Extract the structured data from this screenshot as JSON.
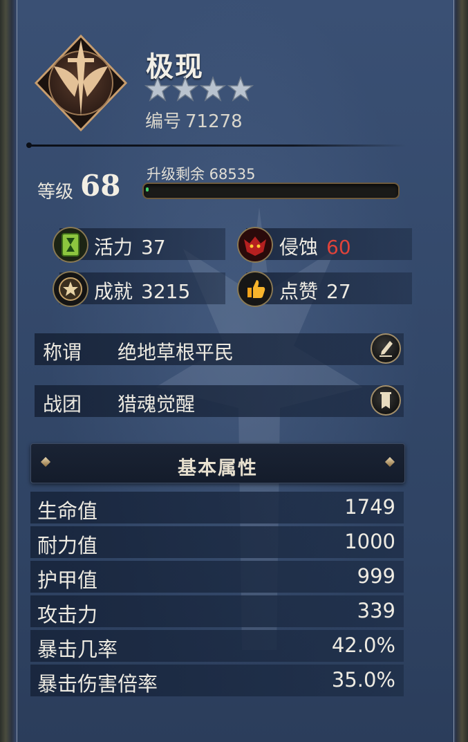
{
  "character": {
    "name": "极现",
    "star_count": 4,
    "id_label": "编号",
    "id_value": "71278"
  },
  "level": {
    "label": "等级",
    "value": "68",
    "xp_label": "升级剩余 68535",
    "xp_progress": 0.01
  },
  "stats": {
    "vitality": {
      "label": "活力",
      "value": "37",
      "icon": "hourglass-icon"
    },
    "corrosion": {
      "label": "侵蚀",
      "value": "60",
      "icon": "demon-icon",
      "value_color": "#e0433a"
    },
    "achievement": {
      "label": "成就",
      "value": "3215",
      "icon": "star-medal-icon"
    },
    "likes": {
      "label": "点赞",
      "value": "27",
      "icon": "thumbs-up-icon"
    }
  },
  "title_row": {
    "label": "称谓",
    "value": "绝地草根平民",
    "button_icon": "quill-icon"
  },
  "guild_row": {
    "label": "战团",
    "value": "猎魂觉醒",
    "button_icon": "banner-icon"
  },
  "attributes": {
    "header": "基本属性",
    "rows": [
      {
        "label": "生命值",
        "value": "1749"
      },
      {
        "label": "耐力值",
        "value": "1000"
      },
      {
        "label": "护甲值",
        "value": "999"
      },
      {
        "label": "攻击力",
        "value": "339"
      },
      {
        "label": "暴击几率",
        "value": "42.0%"
      },
      {
        "label": "暴击伤害倍率",
        "value": "35.0%"
      }
    ]
  }
}
